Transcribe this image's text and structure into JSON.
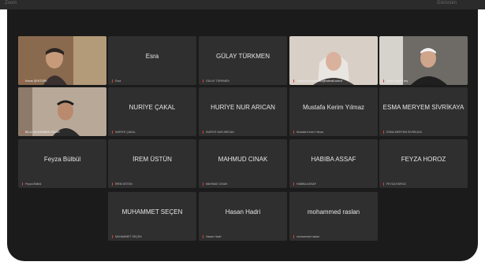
{
  "topbar": {
    "left_text": "Zoom",
    "right_text": "Görünüm"
  },
  "participants": [
    {
      "name_center": "",
      "caption": "Kenan ŞENTÜRK",
      "video": true,
      "speaking": true
    },
    {
      "name_center": "Esra",
      "caption": "Esra",
      "video": false
    },
    {
      "name_center": "GÜLAY TÜRKMEN",
      "caption": "GÜLAY TÜRKMEN",
      "video": false
    },
    {
      "name_center": "",
      "caption": "hatice@nurhaticeduz@hotmail.com.tr",
      "video": true
    },
    {
      "name_center": "",
      "caption": "Yusuf Faruk Tunç",
      "video": true
    },
    {
      "name_center": "",
      "caption": "BİLAL MUHAMMED DEMİR",
      "video": true
    },
    {
      "name_center": "NURİYE ÇAKAL",
      "caption": "NURİYE ÇAKAL",
      "video": false
    },
    {
      "name_center": "HURİYE NUR ARICAN",
      "caption": "HURİYE NUR ARICAN",
      "video": false
    },
    {
      "name_center": "Mustafa Kerim Yılmaz",
      "caption": "Mustafa Kerim Yılmaz",
      "video": false
    },
    {
      "name_center": "ESMA MERYEM SİVRİKAYA",
      "caption": "ESMA MERYEM SİVRİKAYA",
      "video": false
    },
    {
      "name_center": "Feyza Bülbül",
      "caption": "Feyza Bülbül",
      "video": false
    },
    {
      "name_center": "İREM ÜSTÜN",
      "caption": "İREM ÜSTÜN",
      "video": false
    },
    {
      "name_center": "MAHMUD CINAK",
      "caption": "MAHMUD CINAK",
      "video": false
    },
    {
      "name_center": "HABIBA ASSAF",
      "caption": "HABIBA ASSAF",
      "video": false
    },
    {
      "name_center": "FEYZA HOROZ",
      "caption": "FEYZA HOROZ",
      "video": false
    },
    {
      "name_center": "MUHAMMET SEÇEN",
      "caption": "MUHAMMET SEÇEN",
      "video": false
    },
    {
      "name_center": "Hasan Hadri",
      "caption": "Hasan Hadri",
      "video": false
    },
    {
      "name_center": "mohammed raslan",
      "caption": "mohammed raslan",
      "video": false
    }
  ],
  "colors": {
    "window_bg": "#1b1b1b",
    "tile_bg": "#2f2f2f",
    "speaker_outline": "#4cbf5a",
    "muted_mic": "#d9463b"
  },
  "icons": {
    "mic": "mic-muted-icon"
  }
}
